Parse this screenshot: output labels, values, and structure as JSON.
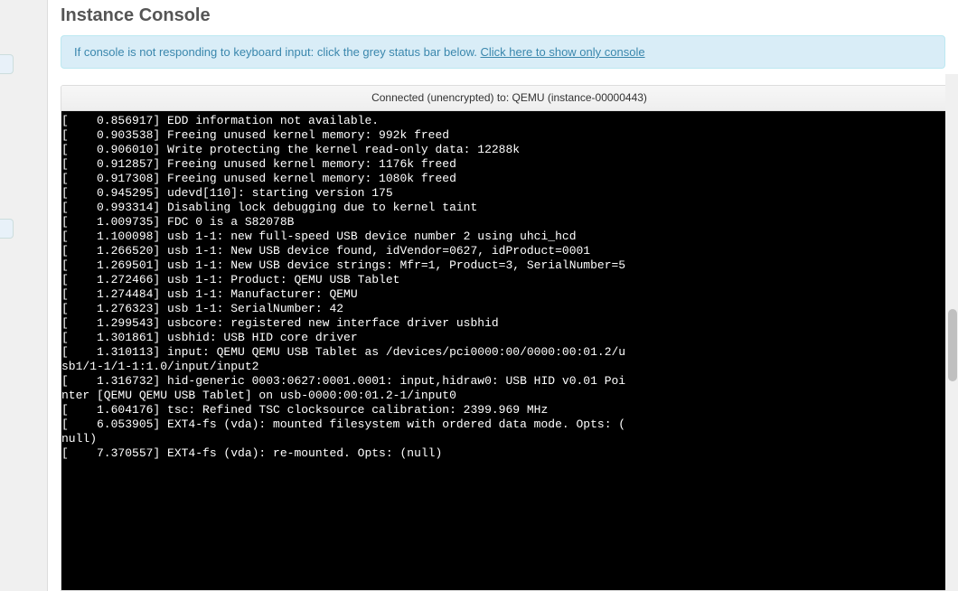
{
  "page": {
    "title": "Instance Console"
  },
  "alert": {
    "text": "If console is not responding to keyboard input: click the grey status bar below. ",
    "link_text": "Click here to show only console"
  },
  "status_bar": {
    "text": "Connected (unencrypted) to: QEMU (instance-00000443)"
  },
  "terminal_lines": [
    "[    0.856917] EDD information not available.",
    "[    0.903538] Freeing unused kernel memory: 992k freed",
    "[    0.906010] Write protecting the kernel read-only data: 12288k",
    "[    0.912857] Freeing unused kernel memory: 1176k freed",
    "[    0.917308] Freeing unused kernel memory: 1080k freed",
    "[    0.945295] udevd[110]: starting version 175",
    "[    0.993314] Disabling lock debugging due to kernel taint",
    "[    1.009735] FDC 0 is a S82078B",
    "[    1.100098] usb 1-1: new full-speed USB device number 2 using uhci_hcd",
    "[    1.266520] usb 1-1: New USB device found, idVendor=0627, idProduct=0001",
    "[    1.269501] usb 1-1: New USB device strings: Mfr=1, Product=3, SerialNumber=5",
    "[    1.272466] usb 1-1: Product: QEMU USB Tablet",
    "[    1.274484] usb 1-1: Manufacturer: QEMU",
    "[    1.276323] usb 1-1: SerialNumber: 42",
    "[    1.299543] usbcore: registered new interface driver usbhid",
    "[    1.301861] usbhid: USB HID core driver",
    "[    1.310113] input: QEMU QEMU USB Tablet as /devices/pci0000:00/0000:00:01.2/u",
    "sb1/1-1/1-1:1.0/input/input2",
    "[    1.316732] hid-generic 0003:0627:0001.0001: input,hidraw0: USB HID v0.01 Poi",
    "nter [QEMU QEMU USB Tablet] on usb-0000:00:01.2-1/input0",
    "[    1.604176] tsc: Refined TSC clocksource calibration: 2399.969 MHz",
    "[    6.053905] EXT4-fs (vda): mounted filesystem with ordered data mode. Opts: (",
    "null)",
    "[    7.370557] EXT4-fs (vda): re-mounted. Opts: (null)"
  ]
}
